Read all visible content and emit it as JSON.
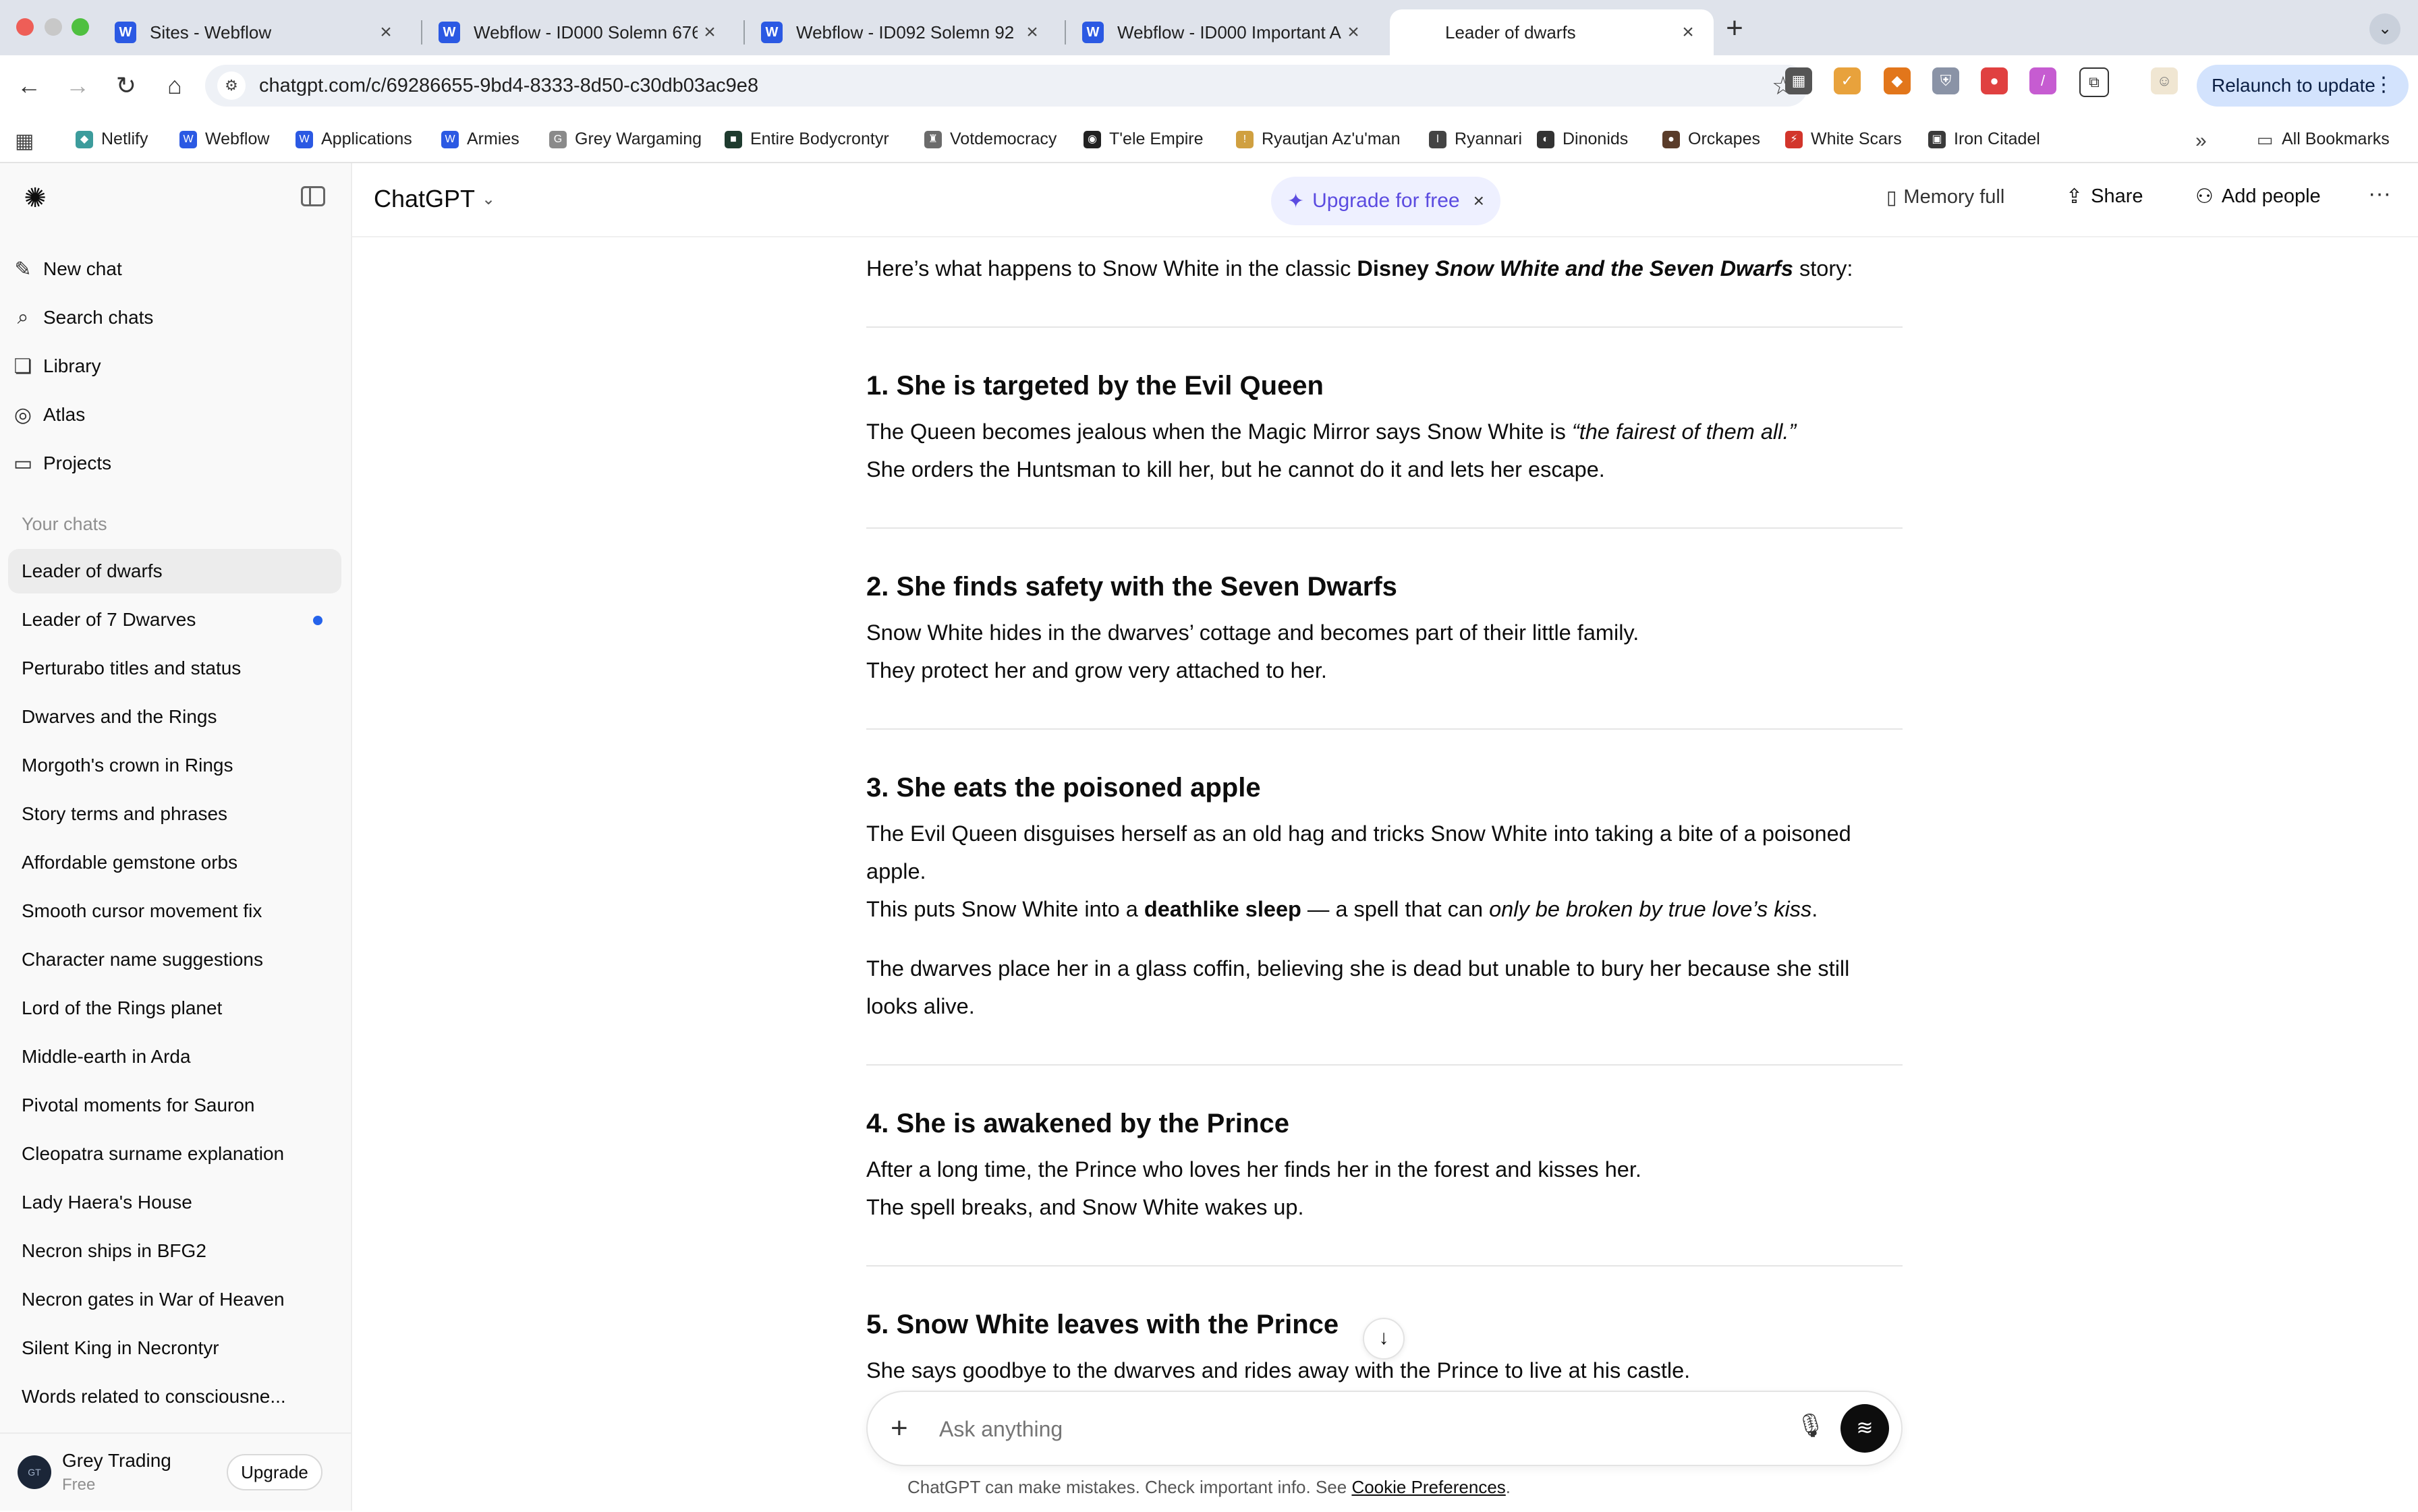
{
  "browser": {
    "tabs": [
      {
        "title": "Sites - Webflow",
        "active": false
      },
      {
        "title": "Webflow - ID000 Solemn 676",
        "active": false
      },
      {
        "title": "Webflow - ID092 Solemn 92",
        "active": false
      },
      {
        "title": "Webflow - ID000 Important A",
        "active": false
      },
      {
        "title": "Leader of dwarfs",
        "active": true
      }
    ],
    "address": "chatgpt.com/c/69286655-9bd4-8333-8d50-c30db03ac9e8",
    "relaunch_label": "Relaunch to update",
    "bookmarks": [
      {
        "label": "Netlify",
        "icon": "netlify-icon",
        "color": "#3c9c9c"
      },
      {
        "label": "Webflow",
        "icon": "webflow-icon",
        "color": "#2b59e3"
      },
      {
        "label": "Applications",
        "icon": "webflow-icon",
        "color": "#2b59e3"
      },
      {
        "label": "Armies",
        "icon": "webflow-icon",
        "color": "#2b59e3"
      },
      {
        "label": "Grey Wargaming",
        "icon": "g-icon",
        "color": "#8a8a8a"
      },
      {
        "label": "Entire Bodycrontyr",
        "icon": "dark-square-icon",
        "color": "#1e3b2e"
      },
      {
        "label": "Votdemocracy",
        "icon": "bottle-icon",
        "color": "#6b6b6b"
      },
      {
        "label": "T'ele Empire",
        "icon": "emblem-icon",
        "color": "#222222"
      },
      {
        "label": "Ryautjan Az'u'man",
        "icon": "torch-icon",
        "color": "#d0a040"
      },
      {
        "label": "Ryannari",
        "icon": "figure-icon",
        "color": "#444444"
      },
      {
        "label": "Dinonids",
        "icon": "swirl-icon",
        "color": "#333333"
      },
      {
        "label": "Orckapes",
        "icon": "orc-icon",
        "color": "#5a3c2a"
      },
      {
        "label": "White Scars",
        "icon": "lightning-icon",
        "color": "#d2352b"
      },
      {
        "label": "Iron Citadel",
        "icon": "citadel-icon",
        "color": "#3a3a3a"
      }
    ],
    "all_bookmarks_label": "All Bookmarks"
  },
  "sidebar": {
    "nav": [
      {
        "label": "New chat",
        "icon": "compose-icon"
      },
      {
        "label": "Search chats",
        "icon": "search-icon"
      },
      {
        "label": "Library",
        "icon": "library-icon"
      },
      {
        "label": "Atlas",
        "icon": "atlas-icon"
      },
      {
        "label": "Projects",
        "icon": "folder-icon"
      }
    ],
    "section_title": "Your chats",
    "chats": [
      {
        "title": "Leader of dwarfs",
        "active": true,
        "unread": false
      },
      {
        "title": "Leader of 7 Dwarves",
        "active": false,
        "unread": true
      },
      {
        "title": "Perturabo titles and status",
        "active": false,
        "unread": false
      },
      {
        "title": "Dwarves and the Rings",
        "active": false,
        "unread": false
      },
      {
        "title": "Morgoth's crown in Rings",
        "active": false,
        "unread": false
      },
      {
        "title": "Story terms and phrases",
        "active": false,
        "unread": false
      },
      {
        "title": "Affordable gemstone orbs",
        "active": false,
        "unread": false
      },
      {
        "title": "Smooth cursor movement fix",
        "active": false,
        "unread": false
      },
      {
        "title": "Character name suggestions",
        "active": false,
        "unread": false
      },
      {
        "title": "Lord of the Rings planet",
        "active": false,
        "unread": false
      },
      {
        "title": "Middle-earth in Arda",
        "active": false,
        "unread": false
      },
      {
        "title": "Pivotal moments for Sauron",
        "active": false,
        "unread": false
      },
      {
        "title": "Cleopatra surname explanation",
        "active": false,
        "unread": false
      },
      {
        "title": "Lady Haera's House",
        "active": false,
        "unread": false
      },
      {
        "title": "Necron ships in BFG2",
        "active": false,
        "unread": false
      },
      {
        "title": "Necron gates in War of Heaven",
        "active": false,
        "unread": false
      },
      {
        "title": "Silent King in Necrontyr",
        "active": false,
        "unread": false
      },
      {
        "title": "Words related to consciousne...",
        "active": false,
        "unread": false
      }
    ],
    "user": {
      "name": "Grey Trading",
      "plan": "Free",
      "upgrade_label": "Upgrade"
    }
  },
  "header": {
    "model": "ChatGPT",
    "upgrade_label": "Upgrade for free",
    "memory_label": "Memory full",
    "share_label": "Share",
    "add_people_label": "Add people"
  },
  "message": {
    "intro": {
      "pre": "Here’s what happens to Snow White in the classic ",
      "bold": "Disney ",
      "bold_italic": "Snow White and the Seven Dwarfs",
      "post": " story:"
    },
    "sections": [
      {
        "heading": "1. She is targeted by the Evil Queen",
        "lines": [
          {
            "pre": "The Queen becomes jealous when the Magic Mirror says Snow White is ",
            "italic": "“the fairest of them all.”",
            "post": ""
          },
          {
            "pre": "She orders the Huntsman to kill her, but he cannot do it and lets her escape.",
            "italic": "",
            "post": ""
          }
        ]
      },
      {
        "heading": "2. She finds safety with the Seven Dwarfs",
        "lines": [
          {
            "pre": "Snow White hides in the dwarves’ cottage and becomes part of their little family.",
            "italic": "",
            "post": ""
          },
          {
            "pre": "They protect her and grow very attached to her.",
            "italic": "",
            "post": ""
          }
        ]
      },
      {
        "heading": "3. She eats the poisoned apple",
        "lines": [
          {
            "pre": "The Evil Queen disguises herself as an old hag and tricks Snow White into taking a bite of a poisoned",
            "italic": "",
            "post": ""
          },
          {
            "pre": "apple.",
            "italic": "",
            "post": ""
          }
        ],
        "sleep_line": {
          "pre": "This puts Snow White into a ",
          "bold": "deathlike sleep",
          "mid": " — a spell that can ",
          "italic": "only be broken by true love’s kiss",
          "post": "."
        },
        "extra_lines": [
          "The dwarves place her in a glass coffin, believing she is dead but unable to bury her because she still",
          "looks alive."
        ]
      },
      {
        "heading": "4. She is awakened by the Prince",
        "lines": [
          {
            "pre": "After a long time, the Prince who loves her finds her in the forest and kisses her.",
            "italic": "",
            "post": ""
          },
          {
            "pre": "The spell breaks, and Snow White wakes up.",
            "italic": "",
            "post": ""
          }
        ]
      },
      {
        "heading": "5. Snow White leaves with the Prince",
        "lines": [
          {
            "pre": "She says goodbye to the dwarves and rides away with the Prince to live at his castle.",
            "italic": "",
            "post": ""
          }
        ]
      }
    ]
  },
  "composer": {
    "placeholder": "Ask anything"
  },
  "footer": {
    "text": "ChatGPT can make mistakes. Check important info. See ",
    "link": "Cookie Preferences",
    "end": "."
  },
  "colors": {
    "accent": "#2563eb",
    "upgrade_bg": "#eef0ff",
    "upgrade_text": "#5b4be0",
    "sidebar_active": "#ececec",
    "relaunch_bg": "#d3e3fd"
  }
}
